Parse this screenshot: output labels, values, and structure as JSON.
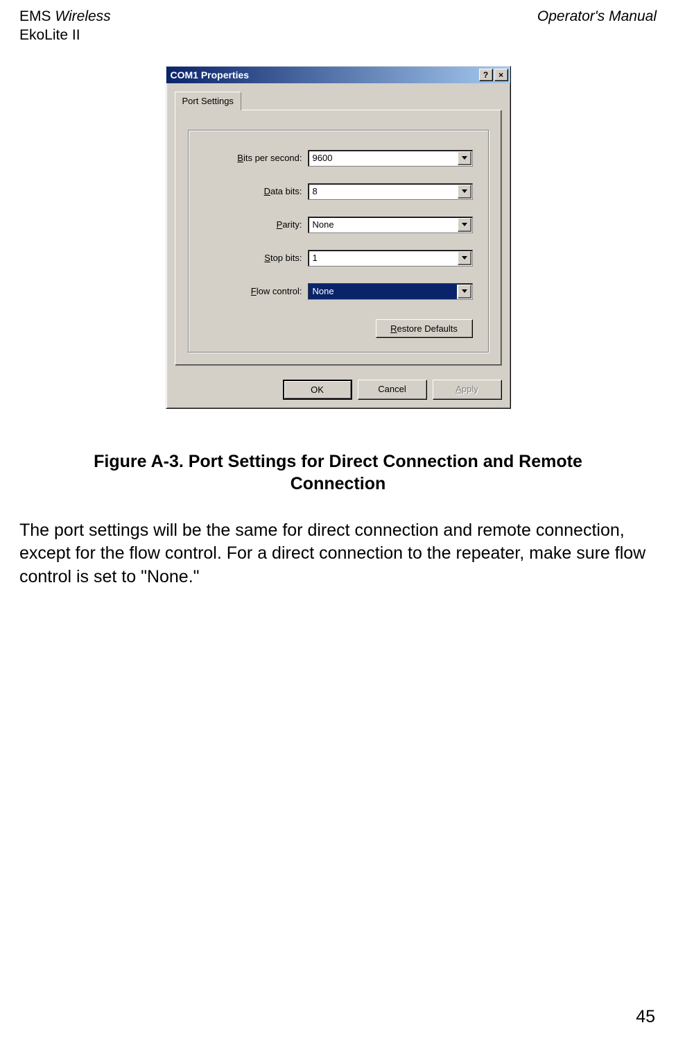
{
  "header": {
    "left_line1_prefix": "EMS",
    "left_line1_italic": " Wireless",
    "left_line2": "EkoLite II",
    "right": "Operator's Manual"
  },
  "dialog": {
    "title": "COM1 Properties",
    "help_glyph": "?",
    "close_glyph": "×",
    "tab_label": "Port Settings",
    "fields": {
      "bits_per_second": {
        "label_pre": "B",
        "label_rest": "its per second:",
        "value": "9600"
      },
      "data_bits": {
        "label_pre": "D",
        "label_rest": "ata bits:",
        "value": "8"
      },
      "parity": {
        "label_pre": "P",
        "label_rest": "arity:",
        "value": "None"
      },
      "stop_bits": {
        "label_pre": "S",
        "label_rest": "top bits:",
        "value": "1"
      },
      "flow_control": {
        "label_pre": "F",
        "label_rest": "low control:",
        "value": "None"
      }
    },
    "restore_pre": "R",
    "restore_rest": "estore Defaults",
    "ok": "OK",
    "cancel": "Cancel",
    "apply_pre": "A",
    "apply_rest": "pply"
  },
  "caption": "Figure A-3.  Port Settings for Direct Connection and Remote Connection",
  "body_text": "The port settings will be the same for direct connection and remote connection, except for the flow control. For a direct connection to the repeater, make sure flow control is set to \"None.\"",
  "page_number": "45"
}
